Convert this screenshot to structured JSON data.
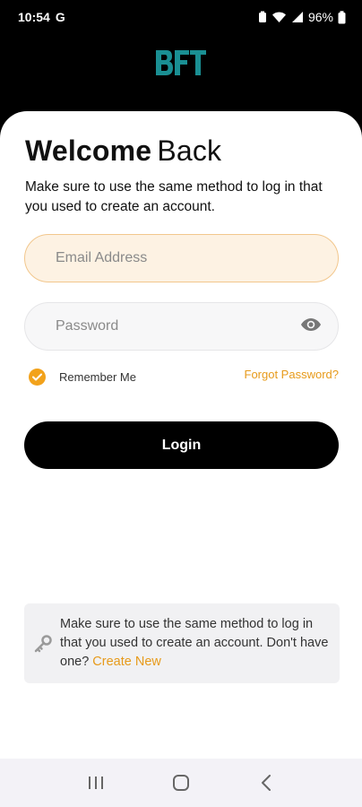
{
  "status_bar": {
    "time": "10:54",
    "carrier_letter": "G",
    "battery": "96%"
  },
  "logo": {
    "text": "BFT"
  },
  "header": {
    "title_bold": "Welcome",
    "title_light": "Back",
    "subtitle": "Make sure to use the same method to log in that you used to create an account."
  },
  "form": {
    "email_placeholder": "Email Address",
    "password_placeholder": "Password",
    "remember_label": "Remember Me",
    "forgot_label": "Forgot Password?",
    "login_label": "Login"
  },
  "info": {
    "text": "Make sure to use the same method to log in that you used to create an account. Don't have one? ",
    "link": "Create New"
  },
  "colors": {
    "accent": "#f2a21b",
    "link": "#e79a1a",
    "logo": "#1a8f93"
  }
}
